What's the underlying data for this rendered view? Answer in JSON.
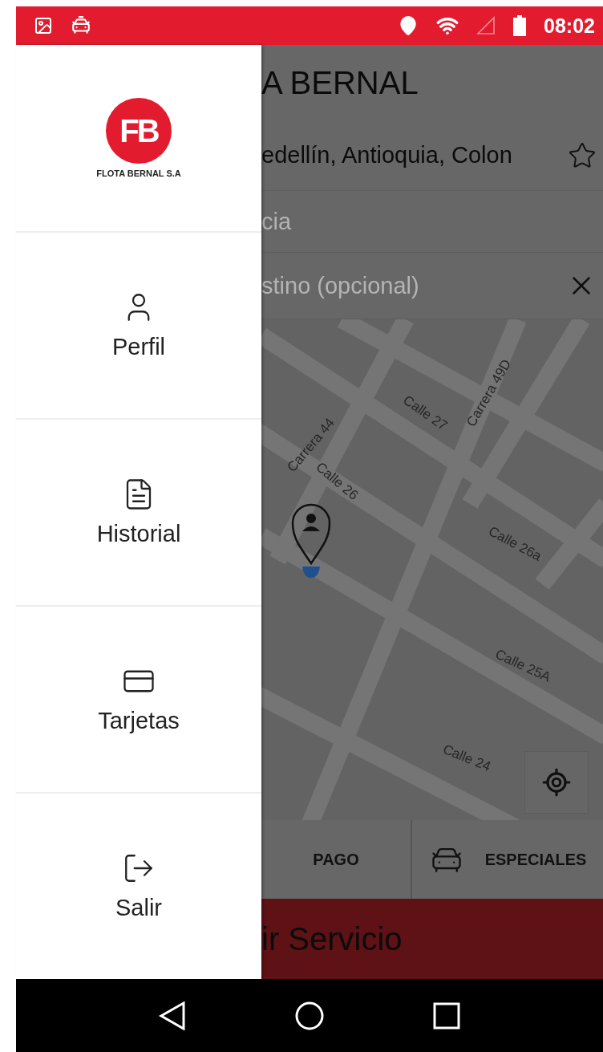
{
  "status_bar": {
    "time": "08:02"
  },
  "app": {
    "title": "A BERNAL",
    "address": "edellín, Antioquia, Colon",
    "favorite": false,
    "origin_field": {
      "placeholder": "cia"
    },
    "destination_field": {
      "placeholder": "stino (opcional)"
    },
    "map": {
      "streets": [
        {
          "name": "Carrera 44"
        },
        {
          "name": "Calle 27"
        },
        {
          "name": "Carrera 49D"
        },
        {
          "name": "Calle 26"
        },
        {
          "name": "Calle 26a"
        },
        {
          "name": "Calle 25A"
        },
        {
          "name": "Calle 24"
        }
      ]
    },
    "tabs": [
      {
        "label": "PAGO",
        "kind": "text"
      },
      {
        "label": "ESPECIALES",
        "kind": "car"
      }
    ],
    "request_button": "ir Servicio"
  },
  "drawer": {
    "logo": {
      "mark": "FB",
      "name": "FLOTA BERNAL S.A"
    },
    "items": [
      {
        "label": "Perfil",
        "kind": "profile"
      },
      {
        "label": "Historial",
        "kind": "history"
      },
      {
        "label": "Tarjetas",
        "kind": "cards"
      },
      {
        "label": "Salir",
        "kind": "logout"
      }
    ]
  }
}
